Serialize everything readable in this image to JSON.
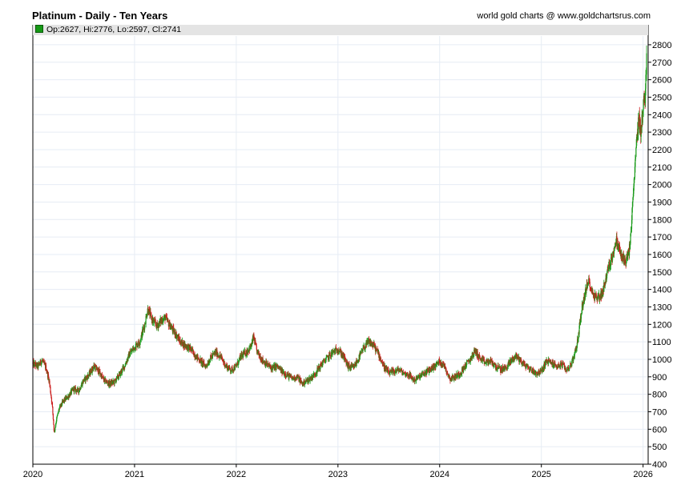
{
  "header": {
    "title": "Platinum - Daily - Ten Years",
    "credit": "world gold charts @ www.goldchartsrus.com",
    "ohlc": "Op:2627, Hi:2776, Lo:2597, Cl:2741"
  },
  "colors": {
    "up": "#1a9a1a",
    "down": "#cc1f1f",
    "grid": "#e6ecf4",
    "axis": "#000000"
  },
  "chart_data": {
    "type": "candlestick",
    "ylim": [
      400,
      2850
    ],
    "y_ticks": [
      400,
      500,
      600,
      700,
      800,
      900,
      1000,
      1100,
      1200,
      1300,
      1400,
      1500,
      1600,
      1700,
      1800,
      1900,
      2000,
      2100,
      2200,
      2300,
      2400,
      2500,
      2600,
      2700,
      2800
    ],
    "x_range": [
      2020.0,
      2026.05
    ],
    "x_ticks": [
      {
        "label": "2020",
        "value": 2020
      },
      {
        "label": "2021",
        "value": 2021
      },
      {
        "label": "2022",
        "value": 2022
      },
      {
        "label": "2023",
        "value": 2023
      },
      {
        "label": "2024",
        "value": 2024
      },
      {
        "label": "2025",
        "value": 2025
      },
      {
        "label": "2026",
        "value": 2026
      }
    ],
    "grid": true,
    "close_path": [
      [
        2020.0,
        975
      ],
      [
        2020.05,
        960
      ],
      [
        2020.09,
        995
      ],
      [
        2020.13,
        950
      ],
      [
        2020.16,
        880
      ],
      [
        2020.19,
        740
      ],
      [
        2020.21,
        580
      ],
      [
        2020.23,
        650
      ],
      [
        2020.26,
        720
      ],
      [
        2020.3,
        760
      ],
      [
        2020.35,
        790
      ],
      [
        2020.4,
        830
      ],
      [
        2020.45,
        820
      ],
      [
        2020.5,
        880
      ],
      [
        2020.55,
        910
      ],
      [
        2020.6,
        960
      ],
      [
        2020.65,
        930
      ],
      [
        2020.7,
        880
      ],
      [
        2020.75,
        860
      ],
      [
        2020.8,
        870
      ],
      [
        2020.85,
        910
      ],
      [
        2020.9,
        960
      ],
      [
        2020.95,
        1030
      ],
      [
        2021.0,
        1070
      ],
      [
        2021.05,
        1100
      ],
      [
        2021.1,
        1200
      ],
      [
        2021.13,
        1290
      ],
      [
        2021.17,
        1230
      ],
      [
        2021.22,
        1190
      ],
      [
        2021.26,
        1220
      ],
      [
        2021.3,
        1240
      ],
      [
        2021.35,
        1190
      ],
      [
        2021.4,
        1150
      ],
      [
        2021.45,
        1100
      ],
      [
        2021.5,
        1080
      ],
      [
        2021.55,
        1060
      ],
      [
        2021.6,
        1020
      ],
      [
        2021.65,
        990
      ],
      [
        2021.7,
        960
      ],
      [
        2021.75,
        1010
      ],
      [
        2021.8,
        1040
      ],
      [
        2021.85,
        1010
      ],
      [
        2021.9,
        960
      ],
      [
        2021.95,
        940
      ],
      [
        2022.0,
        960
      ],
      [
        2022.05,
        1020
      ],
      [
        2022.1,
        1040
      ],
      [
        2022.15,
        1080
      ],
      [
        2022.17,
        1130
      ],
      [
        2022.2,
        1050
      ],
      [
        2022.25,
        1000
      ],
      [
        2022.3,
        970
      ],
      [
        2022.35,
        950
      ],
      [
        2022.4,
        960
      ],
      [
        2022.45,
        930
      ],
      [
        2022.5,
        910
      ],
      [
        2022.55,
        890
      ],
      [
        2022.6,
        900
      ],
      [
        2022.65,
        860
      ],
      [
        2022.7,
        880
      ],
      [
        2022.75,
        900
      ],
      [
        2022.8,
        940
      ],
      [
        2022.85,
        980
      ],
      [
        2022.9,
        1010
      ],
      [
        2022.95,
        1040
      ],
      [
        2023.0,
        1060
      ],
      [
        2023.05,
        1020
      ],
      [
        2023.1,
        960
      ],
      [
        2023.15,
        950
      ],
      [
        2023.2,
        1000
      ],
      [
        2023.25,
        1060
      ],
      [
        2023.3,
        1100
      ],
      [
        2023.35,
        1080
      ],
      [
        2023.4,
        1030
      ],
      [
        2023.45,
        960
      ],
      [
        2023.5,
        920
      ],
      [
        2023.55,
        930
      ],
      [
        2023.6,
        940
      ],
      [
        2023.65,
        920
      ],
      [
        2023.7,
        910
      ],
      [
        2023.75,
        880
      ],
      [
        2023.8,
        900
      ],
      [
        2023.85,
        920
      ],
      [
        2023.9,
        940
      ],
      [
        2023.95,
        960
      ],
      [
        2024.0,
        990
      ],
      [
        2024.05,
        960
      ],
      [
        2024.1,
        890
      ],
      [
        2024.15,
        900
      ],
      [
        2024.2,
        920
      ],
      [
        2024.25,
        960
      ],
      [
        2024.3,
        1000
      ],
      [
        2024.35,
        1050
      ],
      [
        2024.4,
        1000
      ],
      [
        2024.45,
        980
      ],
      [
        2024.5,
        990
      ],
      [
        2024.55,
        960
      ],
      [
        2024.6,
        940
      ],
      [
        2024.65,
        950
      ],
      [
        2024.7,
        990
      ],
      [
        2024.75,
        1020
      ],
      [
        2024.8,
        990
      ],
      [
        2024.85,
        960
      ],
      [
        2024.9,
        940
      ],
      [
        2024.95,
        920
      ],
      [
        2025.0,
        930
      ],
      [
        2025.05,
        990
      ],
      [
        2025.1,
        980
      ],
      [
        2025.15,
        960
      ],
      [
        2025.2,
        970
      ],
      [
        2025.25,
        940
      ],
      [
        2025.3,
        980
      ],
      [
        2025.35,
        1080
      ],
      [
        2025.4,
        1300
      ],
      [
        2025.44,
        1400
      ],
      [
        2025.47,
        1450
      ],
      [
        2025.5,
        1380
      ],
      [
        2025.55,
        1350
      ],
      [
        2025.6,
        1380
      ],
      [
        2025.65,
        1500
      ],
      [
        2025.7,
        1600
      ],
      [
        2025.74,
        1680
      ],
      [
        2025.78,
        1600
      ],
      [
        2025.82,
        1560
      ],
      [
        2025.86,
        1600
      ],
      [
        2025.88,
        1720
      ],
      [
        2025.91,
        2000
      ],
      [
        2025.94,
        2280
      ],
      [
        2025.96,
        2380
      ],
      [
        2025.98,
        2300
      ],
      [
        2026.0,
        2450
      ],
      [
        2026.02,
        2500
      ],
      [
        2026.035,
        2741
      ]
    ]
  }
}
